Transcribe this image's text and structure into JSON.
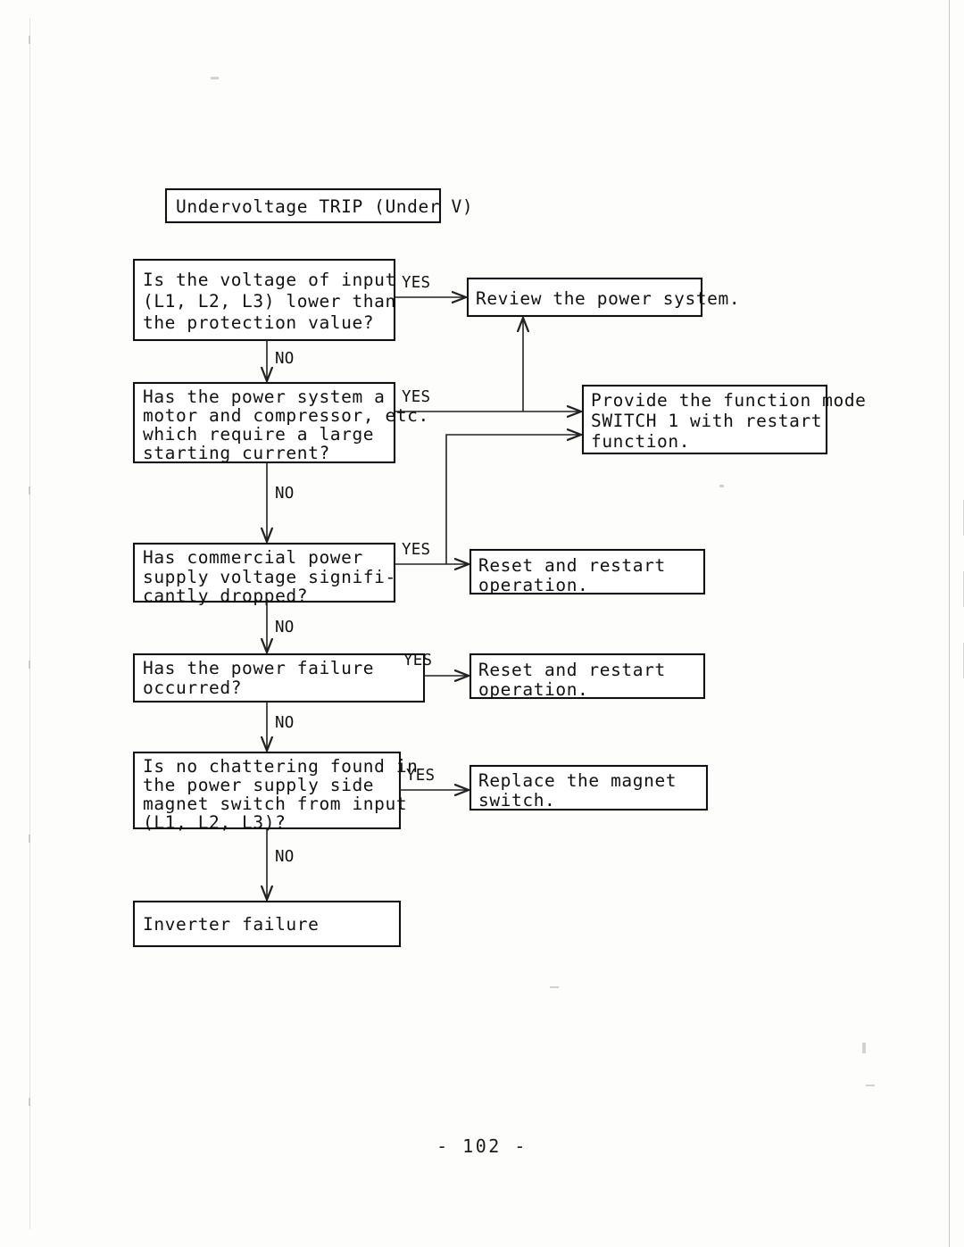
{
  "document": {
    "page_number": "- 102 -",
    "title_box": "Undervoltage TRIP (Under V)"
  },
  "flowchart": {
    "type": "troubleshooting-flowchart",
    "edge_labels": {
      "yes": "YES",
      "no": "NO"
    },
    "decisions": [
      {
        "id": "d1",
        "lines": [
          "Is the voltage of input",
          "(L1, L2, L3) lower than",
          "the protection value?"
        ],
        "yes_target": "r1",
        "no_target": "d2"
      },
      {
        "id": "d2",
        "lines": [
          "Has the power system a",
          "motor and compressor, etc.",
          "which require a large",
          "starting current?"
        ],
        "yes_target": "r2",
        "no_target": "d3"
      },
      {
        "id": "d3",
        "lines": [
          "Has commercial power",
          "supply voltage signifi-",
          "cantly dropped?"
        ],
        "yes_target": "r3",
        "no_target": "d4"
      },
      {
        "id": "d4",
        "lines": [
          "Has the power failure",
          "occurred?"
        ],
        "yes_target": "r4",
        "no_target": "d5"
      },
      {
        "id": "d5",
        "lines": [
          "Is no chattering found in",
          "the power supply side",
          "magnet switch from input",
          "(L1, L2, L3)?"
        ],
        "yes_target": "r5",
        "no_target": "end"
      }
    ],
    "results": [
      {
        "id": "r1",
        "lines": [
          "Review the power system."
        ]
      },
      {
        "id": "r2",
        "lines": [
          "Provide the function mode",
          "SWITCH 1 with restart",
          "function."
        ]
      },
      {
        "id": "r3",
        "lines": [
          "Reset and restart",
          "operation."
        ]
      },
      {
        "id": "r4",
        "lines": [
          "Reset and restart",
          "operation."
        ]
      },
      {
        "id": "r5",
        "lines": [
          "Replace the magnet",
          "switch."
        ]
      }
    ],
    "terminal": {
      "id": "end",
      "lines": [
        "Inverter failure"
      ]
    }
  }
}
